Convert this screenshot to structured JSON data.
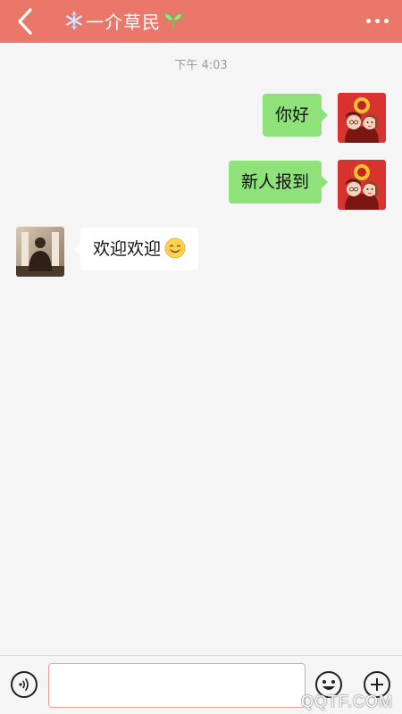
{
  "header": {
    "title": "一介草民",
    "back_icon": "chevron-left-icon",
    "more_icon": "more-dots-icon",
    "title_prefix_icon": "snowflake-icon",
    "title_suffix_icon": "sprout-icon",
    "background_color": "#ea7769"
  },
  "chat": {
    "timestamp": "下午 4:03",
    "messages": [
      {
        "direction": "outgoing",
        "text": "你好",
        "avatar": "couple-cartoon-avatar"
      },
      {
        "direction": "outgoing",
        "text": "新人报到",
        "avatar": "couple-cartoon-avatar"
      },
      {
        "direction": "incoming",
        "text": "欢迎欢迎",
        "emoji": "smiling-face-icon",
        "avatar": "person-photo-avatar"
      }
    ],
    "outgoing_bubble_color": "#8fe27a",
    "incoming_bubble_color": "#ffffff"
  },
  "input_bar": {
    "voice_icon": "voice-icon",
    "input_value": "",
    "input_placeholder": "",
    "emoji_icon": "emoji-face-icon",
    "plus_icon": "plus-circle-icon"
  },
  "watermark": "QQTF.COM"
}
